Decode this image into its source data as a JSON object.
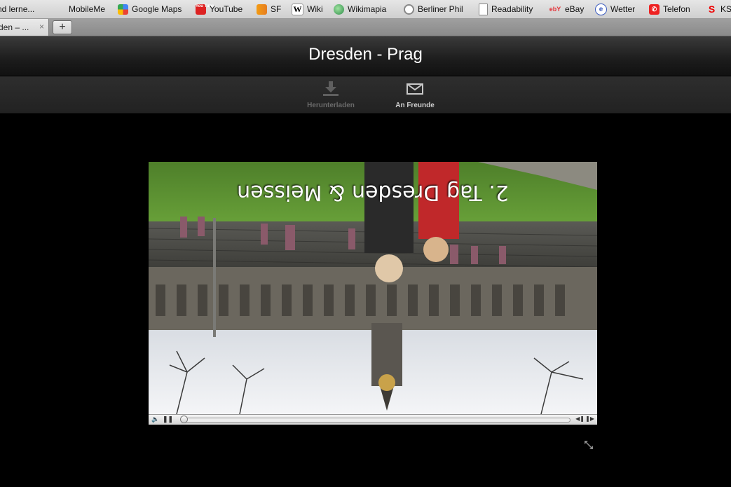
{
  "bookmarks": [
    {
      "label": "nd lerne...",
      "icon": "page-icon"
    },
    {
      "label": "MobileMe",
      "icon": "apple-icon"
    },
    {
      "label": "Google Maps",
      "icon": "google-icon"
    },
    {
      "label": "YouTube",
      "icon": "youtube-icon",
      "badge": "You Tube"
    },
    {
      "label": "SF",
      "icon": "sf-icon"
    },
    {
      "label": "Wiki",
      "icon": "wikipedia-icon",
      "badge": "W"
    },
    {
      "label": "Wikimapia",
      "icon": "globe-icon"
    },
    {
      "label": "Berliner Phil",
      "icon": "circle-icon"
    },
    {
      "label": "Readability",
      "icon": "document-icon"
    },
    {
      "label": "eBay",
      "icon": "ebay-icon",
      "badge": "ebY"
    },
    {
      "label": "Wetter",
      "icon": "weather-icon"
    },
    {
      "label": "Telefon",
      "icon": "phone-icon"
    },
    {
      "label": "KSK",
      "icon": "sparkasse-icon",
      "badge": "S"
    }
  ],
  "tab": {
    "title": "den – ...",
    "close": "×"
  },
  "new_tab": "+",
  "header": {
    "title": "Dresden - Prag"
  },
  "toolbar": {
    "download_label": "Herunterladen",
    "friends_label": "An Freunde"
  },
  "video": {
    "caption": "2. Tag  Dresden & Meissen",
    "progress": 0.02
  },
  "colors": {
    "background": "#000000",
    "header_text": "#ffffff",
    "disabled_text": "#6a6a6a"
  }
}
